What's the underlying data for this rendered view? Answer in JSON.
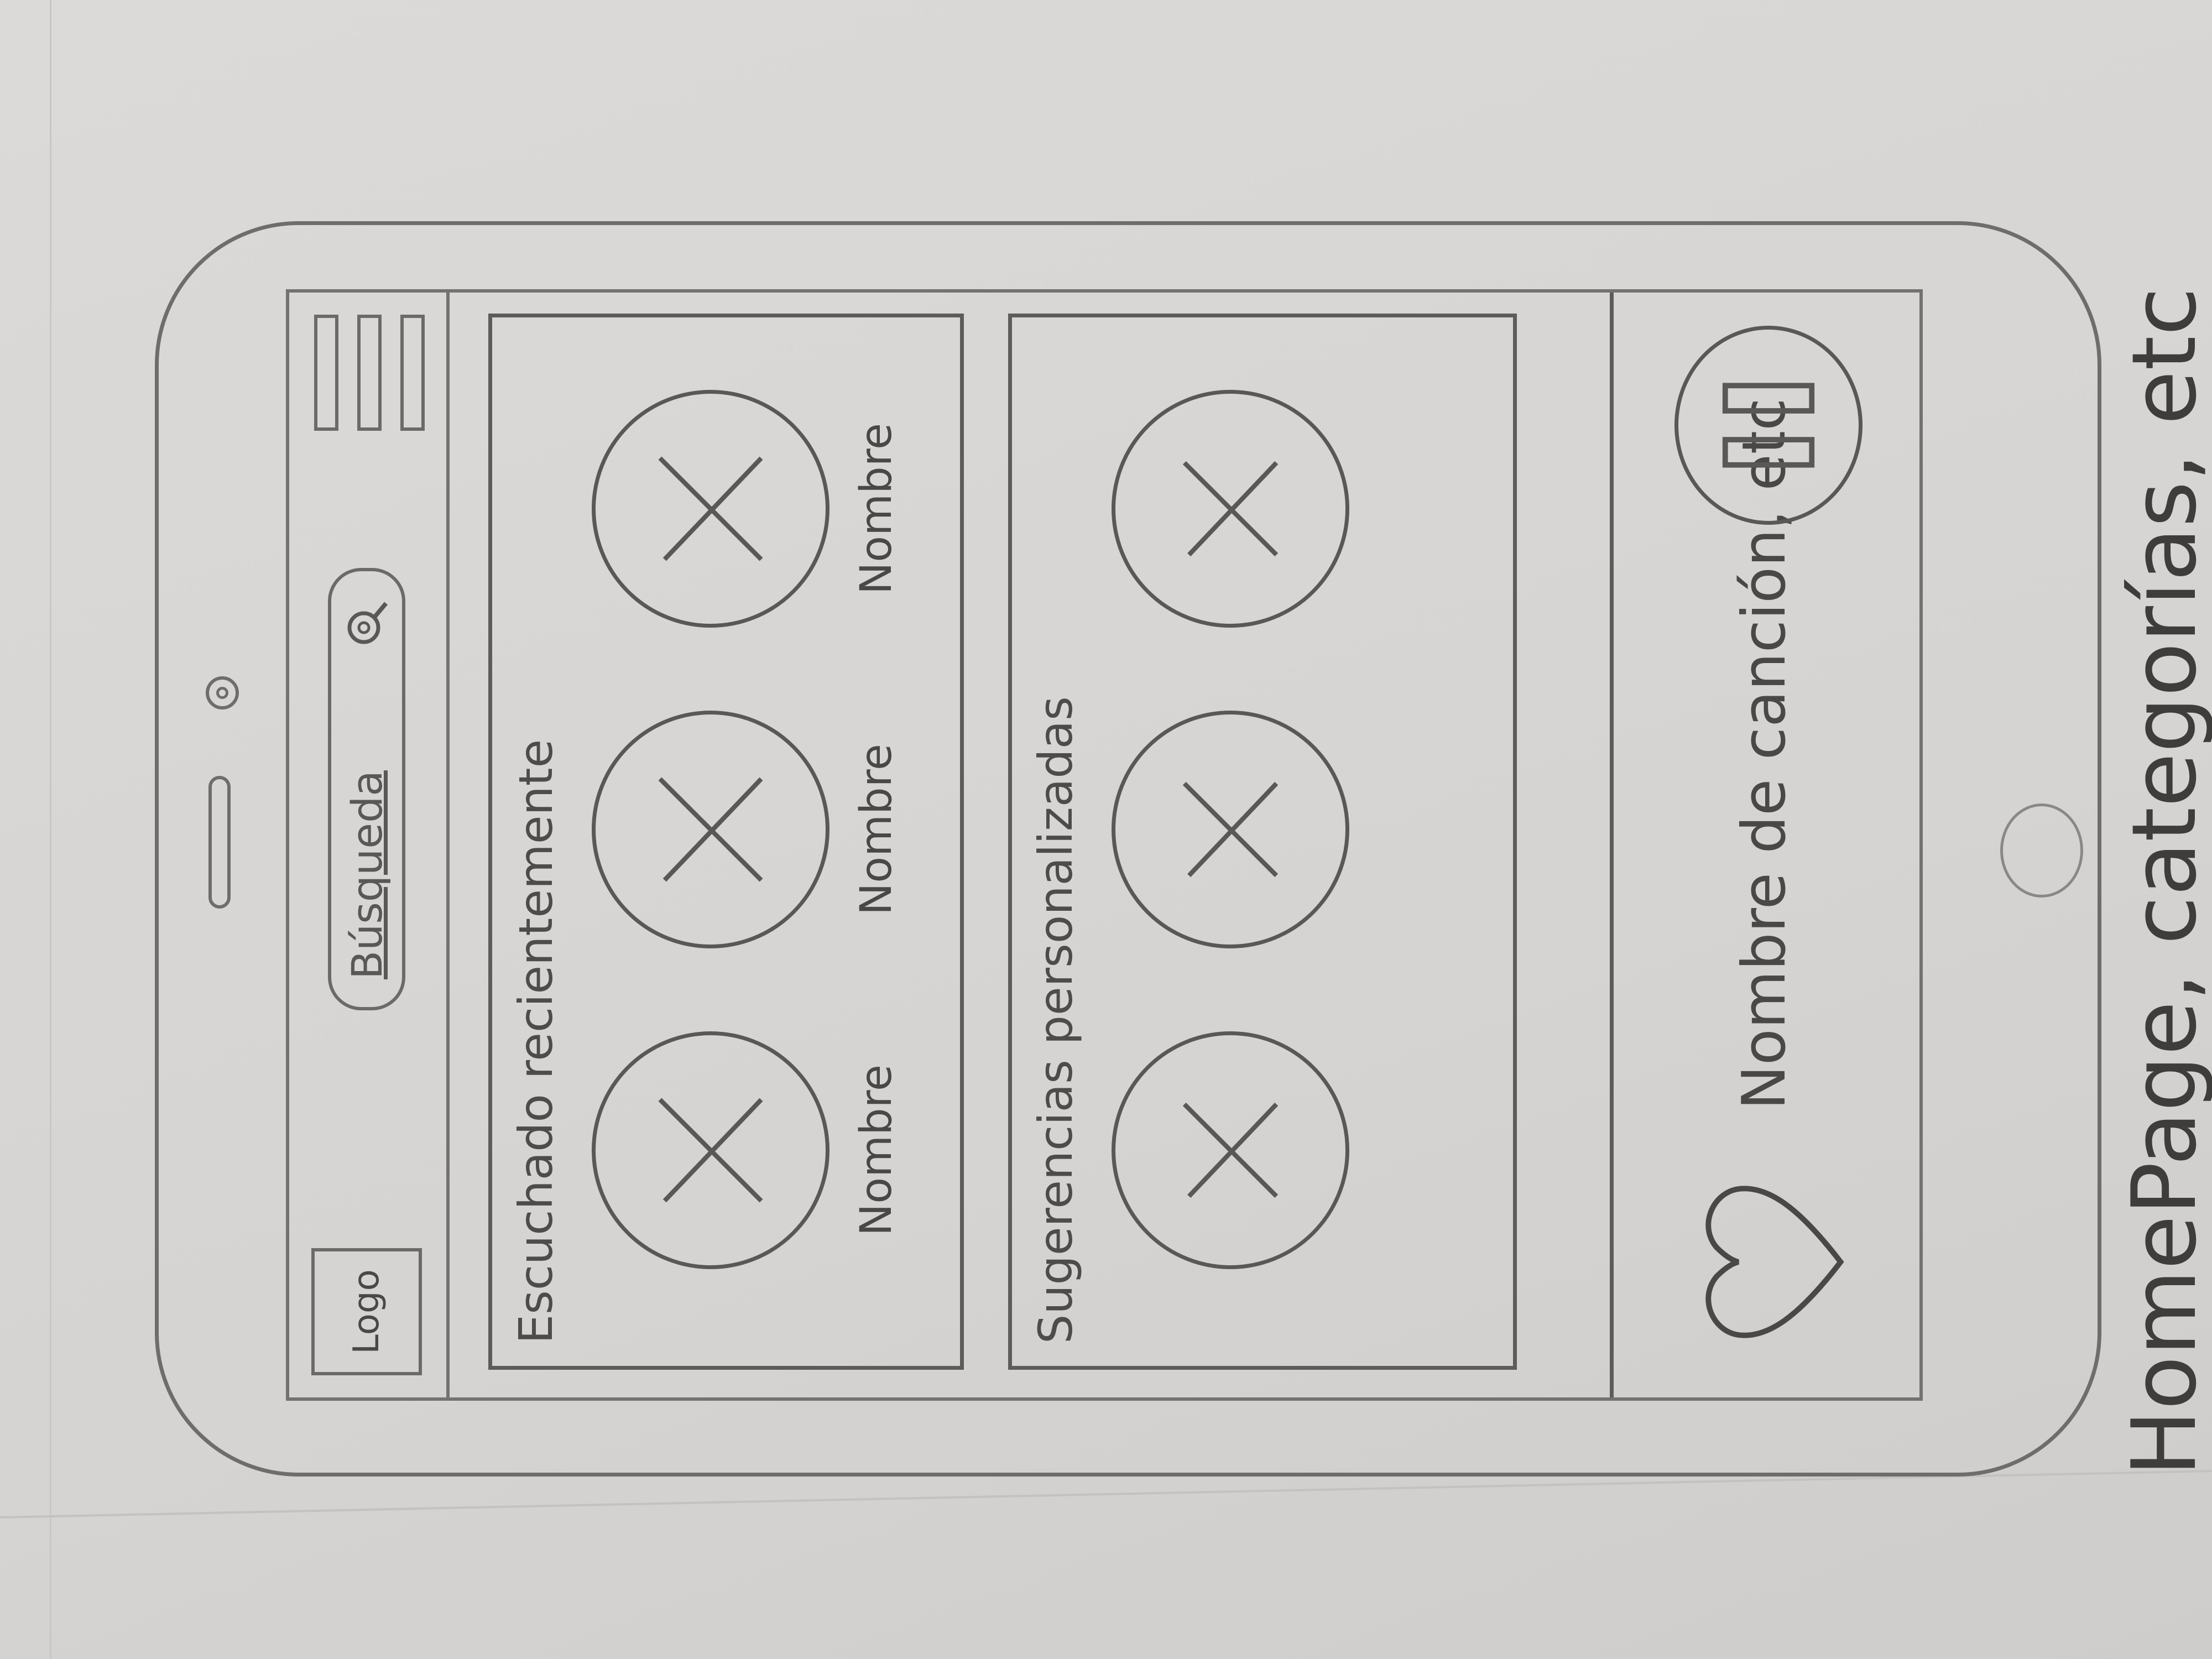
{
  "header": {
    "logo_label": "Logo",
    "search_placeholder": "Búsqueda",
    "search_icon": "search-icon",
    "menu_icon": "hamburger-menu-icon"
  },
  "recent": {
    "title": "Escuchado recientemente",
    "items": [
      {
        "label": "Nombre"
      },
      {
        "label": "Nombre"
      },
      {
        "label": "Nombre"
      }
    ]
  },
  "suggestions": {
    "title": "Sugerencias personalizadas",
    "items": [
      {
        "label": ""
      },
      {
        "label": ""
      },
      {
        "label": ""
      }
    ]
  },
  "player": {
    "like_icon": "heart-icon",
    "song_name": "Nombre de canción, etc",
    "pause_icon": "pause-icon"
  },
  "caption": "HomePage, categorías, etc"
}
